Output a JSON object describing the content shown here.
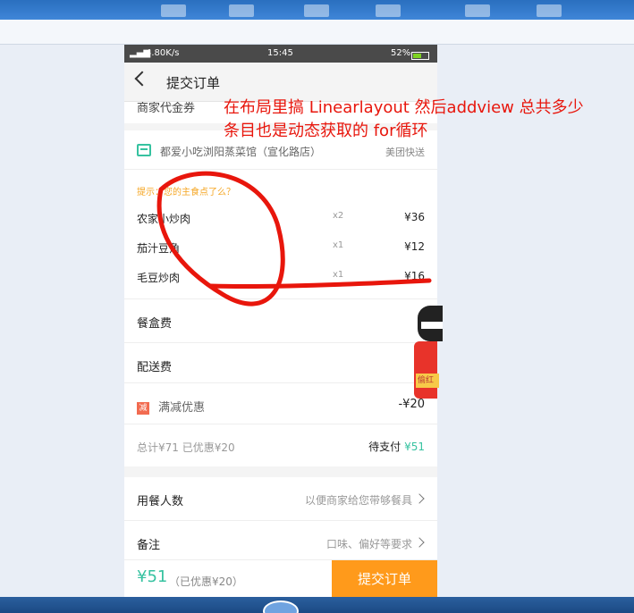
{
  "status_bar": {
    "network": "4.80K/s",
    "time": "15:45",
    "battery": "52%"
  },
  "header": {
    "title": "提交订单"
  },
  "cut_row_label": "商家代金券",
  "shop": {
    "name": "都爱小吃浏阳蒸菜馆（宣化路店）",
    "delivery_tag": "美团快送"
  },
  "tip": "提示：您的主食点了么？",
  "items": [
    {
      "name": "农家小炒肉",
      "qty": "x2",
      "price": "¥36"
    },
    {
      "name": "茄汁豆角",
      "qty": "x1",
      "price": "¥12"
    },
    {
      "name": "毛豆炒肉",
      "qty": "x1",
      "price": "¥16"
    }
  ],
  "fees": {
    "box_label": "餐盒费",
    "box_value": "¥",
    "delivery_label": "配送费",
    "delivery_value": "",
    "discount_icon": "减",
    "discount_label": "满减优惠",
    "discount_value": "-¥20"
  },
  "summary": {
    "total": "总计¥71",
    "saved": "已优惠¥20",
    "pending_label": "待支付",
    "pending_amount": "¥51"
  },
  "options": {
    "diners_label": "用餐人数",
    "diners_hint": "以便商家给您带够餐具",
    "note_label": "备注",
    "note_hint": "口味、偏好等要求"
  },
  "bottom_bar": {
    "price": "¥51",
    "discount": "（已优惠¥20）",
    "submit": "提交订单"
  },
  "mascot_tag": "偷红",
  "annotation": {
    "line1": "在布局里搞 Linearlayout  然后addview  总共多少",
    "line2": "条目也是动态获取的    for循环"
  },
  "colors": {
    "accent": "#36c2a0",
    "submit": "#ff9a1b",
    "annotation": "#e8160c"
  }
}
